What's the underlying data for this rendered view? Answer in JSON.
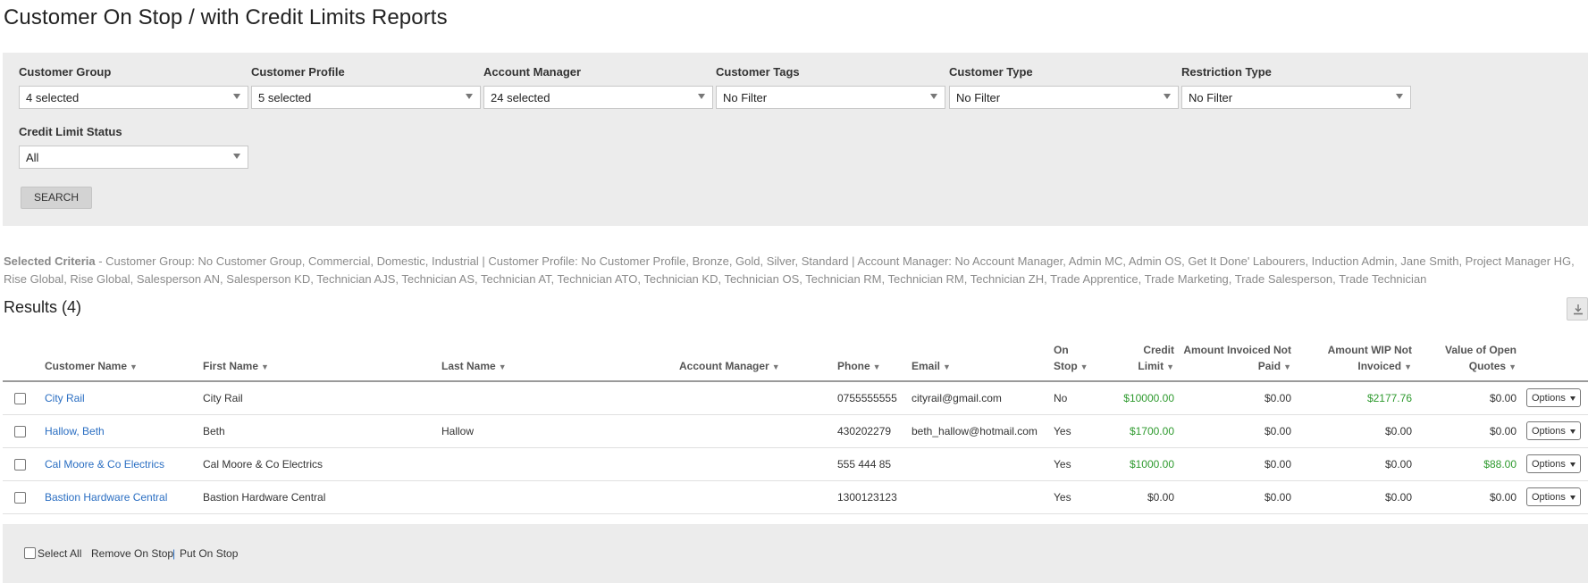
{
  "page": {
    "title": "Customer On Stop / with Credit Limits Reports"
  },
  "filters": [
    {
      "label": "Customer Group",
      "value": "4 selected"
    },
    {
      "label": "Customer Profile",
      "value": "5 selected"
    },
    {
      "label": "Account Manager",
      "value": "24 selected"
    },
    {
      "label": "Customer Tags",
      "value": "No Filter"
    },
    {
      "label": "Customer Type",
      "value": "No Filter"
    },
    {
      "label": "Restriction Type",
      "value": "No Filter"
    },
    {
      "label": "Credit Limit Status",
      "value": "All"
    }
  ],
  "search_label": "SEARCH",
  "criteria": {
    "label": "Selected Criteria",
    "text": " - Customer Group: No Customer Group, Commercial, Domestic, Industrial | Customer Profile: No Customer Profile, Bronze, Gold, Silver, Standard | Account Manager: No Account Manager, Admin MC, Admin OS, Get It Done' Labourers, Induction Admin, Jane Smith, Project Manager HG, Rise Global, Rise Global, Salesperson AN, Salesperson KD, Technician AJS, Technician AS, Technician AT, Technician ATO, Technician KD, Technician OS, Technician RM, Technician RM, Technician ZH, Trade Apprentice, Trade Marketing, Trade Salesperson, Trade Technician"
  },
  "results": {
    "title": "Results (4)"
  },
  "table": {
    "headers": {
      "customer_name": "Customer Name",
      "first_name": "First Name",
      "last_name": "Last Name",
      "account_manager": "Account Manager",
      "phone": "Phone",
      "email": "Email",
      "on_stop_1": "On",
      "on_stop_2": "Stop",
      "credit_limit_1": "Credit",
      "credit_limit_2": "Limit",
      "invoiced_1": "Amount Invoiced Not",
      "invoiced_2": "Paid",
      "wip_1": "Amount WIP Not",
      "wip_2": "Invoiced",
      "quotes_1": "Value of Open",
      "quotes_2": "Quotes"
    },
    "rows": [
      {
        "customer_name": "City Rail",
        "first_name": "City Rail",
        "last_name": "",
        "account_manager": "",
        "phone": "0755555555",
        "email": "cityrail@gmail.com",
        "on_stop": "No",
        "credit_limit": "$10000.00",
        "invoiced_not_paid": "$0.00",
        "wip_not_invoiced": "$2177.76",
        "open_quotes": "$0.00",
        "options": "Options"
      },
      {
        "customer_name": "Hallow, Beth",
        "first_name": "Beth",
        "last_name": "Hallow",
        "account_manager": "",
        "phone": "430202279",
        "email": "beth_hallow@hotmail.com",
        "on_stop": "Yes",
        "credit_limit": "$1700.00",
        "invoiced_not_paid": "$0.00",
        "wip_not_invoiced": "$0.00",
        "open_quotes": "$0.00",
        "options": "Options"
      },
      {
        "customer_name": "Cal Moore & Co Electrics",
        "first_name": "Cal Moore & Co Electrics",
        "last_name": "",
        "account_manager": "",
        "phone": "555 444 85",
        "email": "",
        "on_stop": "Yes",
        "credit_limit": "$1000.00",
        "invoiced_not_paid": "$0.00",
        "wip_not_invoiced": "$0.00",
        "open_quotes": "$88.00",
        "options": "Options"
      },
      {
        "customer_name": "Bastion Hardware Central",
        "first_name": "Bastion Hardware Central",
        "last_name": "",
        "account_manager": "",
        "phone": "1300123123",
        "email": "",
        "on_stop": "Yes",
        "credit_limit": "$0.00",
        "invoiced_not_paid": "$0.00",
        "wip_not_invoiced": "$0.00",
        "open_quotes": "$0.00",
        "options": "Options"
      }
    ]
  },
  "footer": {
    "select_all": "Select All",
    "remove_on_stop": "Remove On Stop",
    "separator": "|",
    "put_on_stop": "Put On Stop"
  },
  "colors": {
    "link": "#2a6ec2",
    "positive": "#2e9a2e",
    "panel": "#ececec"
  },
  "icons": {
    "download": "download-icon",
    "sort": "caret-down-icon"
  }
}
